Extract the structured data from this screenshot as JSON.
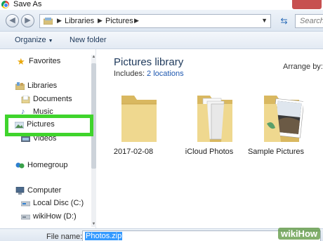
{
  "window": {
    "title": "Save As"
  },
  "address": {
    "crumbs": [
      "Libraries",
      "Pictures"
    ],
    "search_placeholder": "Search"
  },
  "toolbar": {
    "organize_label": "Organize",
    "new_folder_label": "New folder"
  },
  "nav": {
    "items": [
      {
        "label": "Favorites",
        "icon": "star-icon"
      },
      {
        "label": "Libraries",
        "icon": "libraries-icon"
      },
      {
        "label": "Documents",
        "icon": "documents-icon"
      },
      {
        "label": "Music",
        "icon": "music-icon"
      },
      {
        "label": "Pictures",
        "icon": "pictures-icon"
      },
      {
        "label": "Videos",
        "icon": "videos-icon"
      },
      {
        "label": "Homegroup",
        "icon": "homegroup-icon"
      },
      {
        "label": "Computer",
        "icon": "computer-icon"
      },
      {
        "label": "Local Disc (C:)",
        "icon": "drive-icon"
      },
      {
        "label": "wikiHow (D:)",
        "icon": "drive-icon"
      }
    ]
  },
  "content": {
    "title": "Pictures library",
    "includes_label": "Includes:",
    "includes_link": "2 locations",
    "arrange_label": "Arrange by:",
    "folders": [
      {
        "label": "2017-02-08"
      },
      {
        "label": "iCloud Photos"
      },
      {
        "label": "Sample Pictures"
      }
    ]
  },
  "footer": {
    "file_name_label": "File name:",
    "file_name_value": "Photos.zip"
  },
  "watermark": {
    "text": "wikiHow"
  },
  "colors": {
    "highlight": "#3fd42c",
    "folder": "#e8cc7a",
    "link": "#1f58b0",
    "selection": "#3399ff"
  }
}
